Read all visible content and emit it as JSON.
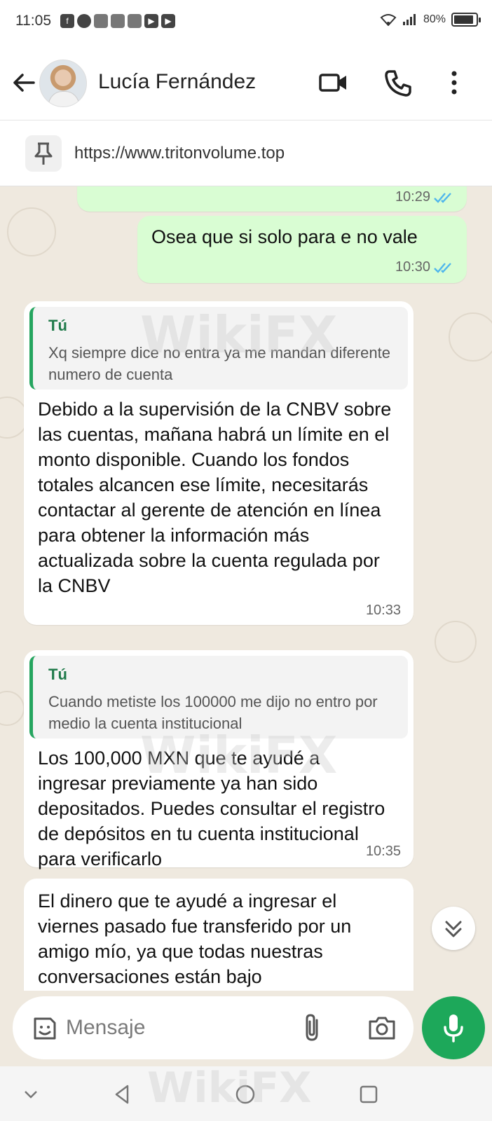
{
  "status_bar": {
    "time": "11:05",
    "battery": "80%",
    "notification_icons": [
      "facebook-icon",
      "chat-icon",
      "app-icon",
      "app-icon",
      "app-icon",
      "youtube-icon",
      "youtube-icon"
    ]
  },
  "header": {
    "contact_name": "Lucía Fernández",
    "icons": [
      "back-arrow-icon",
      "video-call-icon",
      "phone-icon",
      "more-vert-icon"
    ]
  },
  "pinned": {
    "text": "https://www.tritonvolume.top",
    "icon": "pin-icon"
  },
  "watermark": "WikiFX",
  "messages": [
    {
      "direction": "out",
      "text": "",
      "time": "10:29",
      "status": "read"
    },
    {
      "direction": "out",
      "text": "Osea que si solo para e no vale",
      "time": "10:30",
      "status": "read"
    },
    {
      "direction": "in",
      "quote_author": "Tú",
      "quote_text": "Xq siempre dice no entra ya me mandan diferente numero de cuenta",
      "text": "Debido a la supervisión de la CNBV sobre las cuentas, mañana habrá un límite en el monto disponible. Cuando los fondos totales alcancen ese límite, necesitarás contactar al gerente de atención en línea para obtener la información más actualizada sobre la cuenta regulada por la CNBV",
      "time": "10:33"
    },
    {
      "direction": "in",
      "quote_author": "Tú",
      "quote_text": "Cuando metiste los 100000 me dijo no entro por medio la cuenta institucional",
      "text": "Los 100,000 MXN que te ayudé a ingresar previamente ya han sido depositados. Puedes consultar el registro de depósitos en tu cuenta institucional para verificarlo",
      "time": "10:35"
    },
    {
      "direction": "in",
      "text": "El dinero que te ayudé a ingresar el viernes pasado fue transferido por un amigo mío, ya que todas nuestras conversaciones están bajo",
      "time": ""
    }
  ],
  "input": {
    "placeholder": "Mensaje",
    "icons": [
      "emoji-icon",
      "attach-icon",
      "camera-icon",
      "mic-icon"
    ]
  },
  "colors": {
    "outgoing_bubble": "#d9fdd3",
    "incoming_bubble": "#ffffff",
    "chat_background": "#efe9df",
    "accent_green": "#1da85a",
    "quote_bar": "#25a55f",
    "read_ticks": "#4fb6ec"
  }
}
